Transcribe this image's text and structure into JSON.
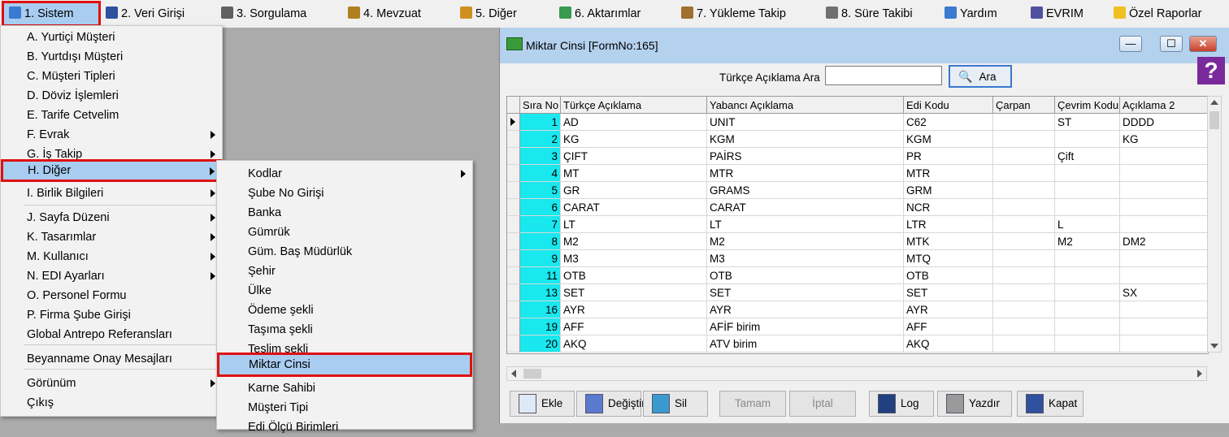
{
  "menubar": {
    "items": [
      {
        "label": "1.  Sistem",
        "icon": "system-icon",
        "color": "#3a7ad0"
      },
      {
        "label": "2.  Veri Girişi",
        "icon": "data-entry-icon",
        "color": "#3050a0"
      },
      {
        "label": "3.  Sorgulama",
        "icon": "query-icon",
        "color": "#606060"
      },
      {
        "label": "4.  Mevzuat",
        "icon": "legislation-icon",
        "color": "#b08020"
      },
      {
        "label": "5.  Diğer",
        "icon": "other-icon",
        "color": "#d09020"
      },
      {
        "label": "6.  Aktarımlar",
        "icon": "transfer-icon",
        "color": "#3a9a50"
      },
      {
        "label": "7.  Yükleme Takip",
        "icon": "loading-tracking-icon",
        "color": "#a07030"
      },
      {
        "label": "8. Süre Takibi",
        "icon": "duration-tracking-icon",
        "color": "#707070"
      },
      {
        "label": "Yardım",
        "icon": "help-icon",
        "color": "#3a7ad0"
      },
      {
        "label": "EVRIM",
        "icon": "evrim-icon",
        "color": "#5050a0"
      },
      {
        "label": "Özel Raporlar",
        "icon": "star-icon",
        "color": "#f0c020"
      }
    ]
  },
  "main_menu": {
    "items": [
      {
        "label": "A.  Yurtiçi Müşteri",
        "arrow": false
      },
      {
        "label": "B.  Yurtdışı Müşteri",
        "arrow": false
      },
      {
        "label": "C.  Müşteri Tipleri",
        "arrow": false
      },
      {
        "label": "D.  Döviz İşlemleri",
        "arrow": false
      },
      {
        "label": "E.  Tarife Cetvelim",
        "arrow": false
      },
      {
        "label": "F.  Evrak",
        "arrow": true
      },
      {
        "label": "G.  İş Takip",
        "arrow": true
      },
      {
        "label": "H.  Diğer",
        "arrow": true
      },
      {
        "label": "I.  Birlik Bilgileri",
        "arrow": true
      },
      {
        "label": "J.  Sayfa Düzeni",
        "arrow": true
      },
      {
        "label": "K.  Tasarımlar",
        "arrow": true
      },
      {
        "label": "M.  Kullanıcı",
        "arrow": true
      },
      {
        "label": "N.  EDI Ayarları",
        "arrow": true
      },
      {
        "label": "O.  Personel Formu",
        "arrow": false
      },
      {
        "label": "P.  Firma Şube Girişi",
        "arrow": false
      },
      {
        "label": "Global Antrepo Referansları",
        "arrow": false
      },
      {
        "label": "Beyanname Onay Mesajları",
        "arrow": false
      },
      {
        "label": "Görünüm",
        "arrow": true
      },
      {
        "label": "Çıkış",
        "arrow": false
      }
    ]
  },
  "sub_menu": {
    "items": [
      {
        "label": "Kodlar",
        "arrow": true
      },
      {
        "label": "Şube No Girişi",
        "arrow": false
      },
      {
        "label": "Banka",
        "arrow": false
      },
      {
        "label": "Gümrük",
        "arrow": false
      },
      {
        "label": "Güm. Baş Müdürlük",
        "arrow": false
      },
      {
        "label": "Şehir",
        "arrow": false
      },
      {
        "label": "Ülke",
        "arrow": false
      },
      {
        "label": "Ödeme şekli",
        "arrow": false
      },
      {
        "label": "Taşıma şekli",
        "arrow": false
      },
      {
        "label": "Teslim şekli",
        "arrow": false
      },
      {
        "label": "Miktar Cinsi",
        "arrow": false
      },
      {
        "label": "Karne Sahibi",
        "arrow": false
      },
      {
        "label": "Müşteri  Tipi",
        "arrow": false
      },
      {
        "label": "Edi Ölçü Birimleri",
        "arrow": false
      }
    ]
  },
  "window": {
    "title": "Miktar Cinsi [FormNo:165]",
    "search_label": "Türkçe Açıklama Ara",
    "search_value": "",
    "search_button": "Ara",
    "help_symbol": "?",
    "minimize": "—",
    "maximize": "☐",
    "close": "✕"
  },
  "grid": {
    "columns": [
      "Sıra No",
      "Türkçe Açıklama",
      "Yabancı Açıklama",
      "Edi Kodu",
      "Çarpan",
      "Çevrim Kodu",
      "Açıklama 2"
    ],
    "rows": [
      [
        "1",
        "AD",
        "UNIT",
        "C62",
        "",
        "ST",
        "DDDD"
      ],
      [
        "2",
        "KG",
        "KGM",
        "KGM",
        "",
        "",
        "KG"
      ],
      [
        "3",
        "ÇIFT",
        "PAİRS",
        "PR",
        "",
        "Çift",
        ""
      ],
      [
        "4",
        "MT",
        "MTR",
        "MTR",
        "",
        "",
        ""
      ],
      [
        "5",
        "GR",
        "GRAMS",
        "GRM",
        "",
        "",
        ""
      ],
      [
        "6",
        "CARAT",
        "CARAT",
        "NCR",
        "",
        "",
        ""
      ],
      [
        "7",
        "LT",
        "LT",
        "LTR",
        "",
        "L",
        ""
      ],
      [
        "8",
        "M2",
        "M2",
        "MTK",
        "",
        "M2",
        "DM2"
      ],
      [
        "9",
        "M3",
        "M3",
        "MTQ",
        "",
        "",
        ""
      ],
      [
        "11",
        "OTB",
        "OTB",
        "OTB",
        "",
        "",
        ""
      ],
      [
        "13",
        "SET",
        "SET",
        "SET",
        "",
        "",
        "SX"
      ],
      [
        "16",
        "AYR",
        "AYR",
        "AYR",
        "",
        "",
        ""
      ],
      [
        "19",
        "AFF",
        "AFİF birim",
        "AFF",
        "",
        "",
        ""
      ],
      [
        "20",
        "AKQ",
        "ATV birim",
        "AKQ",
        "",
        "",
        ""
      ]
    ]
  },
  "buttons": [
    {
      "label": "Ekle",
      "icon": "new-document-icon",
      "disabled": false
    },
    {
      "label": "Değiştir",
      "icon": "edit-icon",
      "disabled": false
    },
    {
      "label": "Sil",
      "icon": "recycle-bin-icon",
      "disabled": false
    },
    {
      "label": "Tamam",
      "icon": "",
      "disabled": true
    },
    {
      "label": "İptal",
      "icon": "",
      "disabled": true
    },
    {
      "label": "Log",
      "icon": "log-icon",
      "disabled": false
    },
    {
      "label": "Yazdır",
      "icon": "printer-icon",
      "disabled": false
    },
    {
      "label": "Kapat",
      "icon": "exit-door-icon",
      "disabled": false
    }
  ],
  "colors": {
    "highlight": "#a9cdf0",
    "red_outline": "#e01010",
    "number_cell": "#19e8ee",
    "title_bar": "#b4d1ee"
  }
}
